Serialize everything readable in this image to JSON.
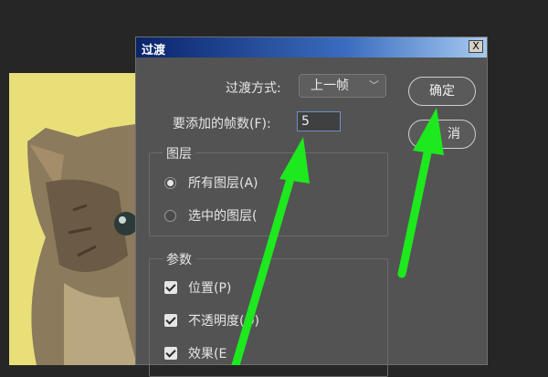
{
  "dialog": {
    "title": "过渡",
    "close_label": "X",
    "transition_label": "过渡方式:",
    "transition_value": "上一帧",
    "frames_label": "要添加的帧数(F):",
    "frames_value": "5",
    "ok_label": "确定",
    "cancel_label": "消"
  },
  "layers_group": {
    "title": "图层",
    "options": [
      {
        "label": "所有图层(A)",
        "selected": true
      },
      {
        "label": "选中的图层(",
        "selected": false
      }
    ]
  },
  "params_group": {
    "title": "参数",
    "options": [
      {
        "label": "位置(P)",
        "checked": true
      },
      {
        "label": "不透明度(O)",
        "checked": true
      },
      {
        "label": "效果(E",
        "checked": true
      }
    ]
  },
  "annotation": {
    "arrow_color": "#1ee81e"
  },
  "icons": {
    "close": "close-icon",
    "dropdown": "chevron-down-icon"
  }
}
